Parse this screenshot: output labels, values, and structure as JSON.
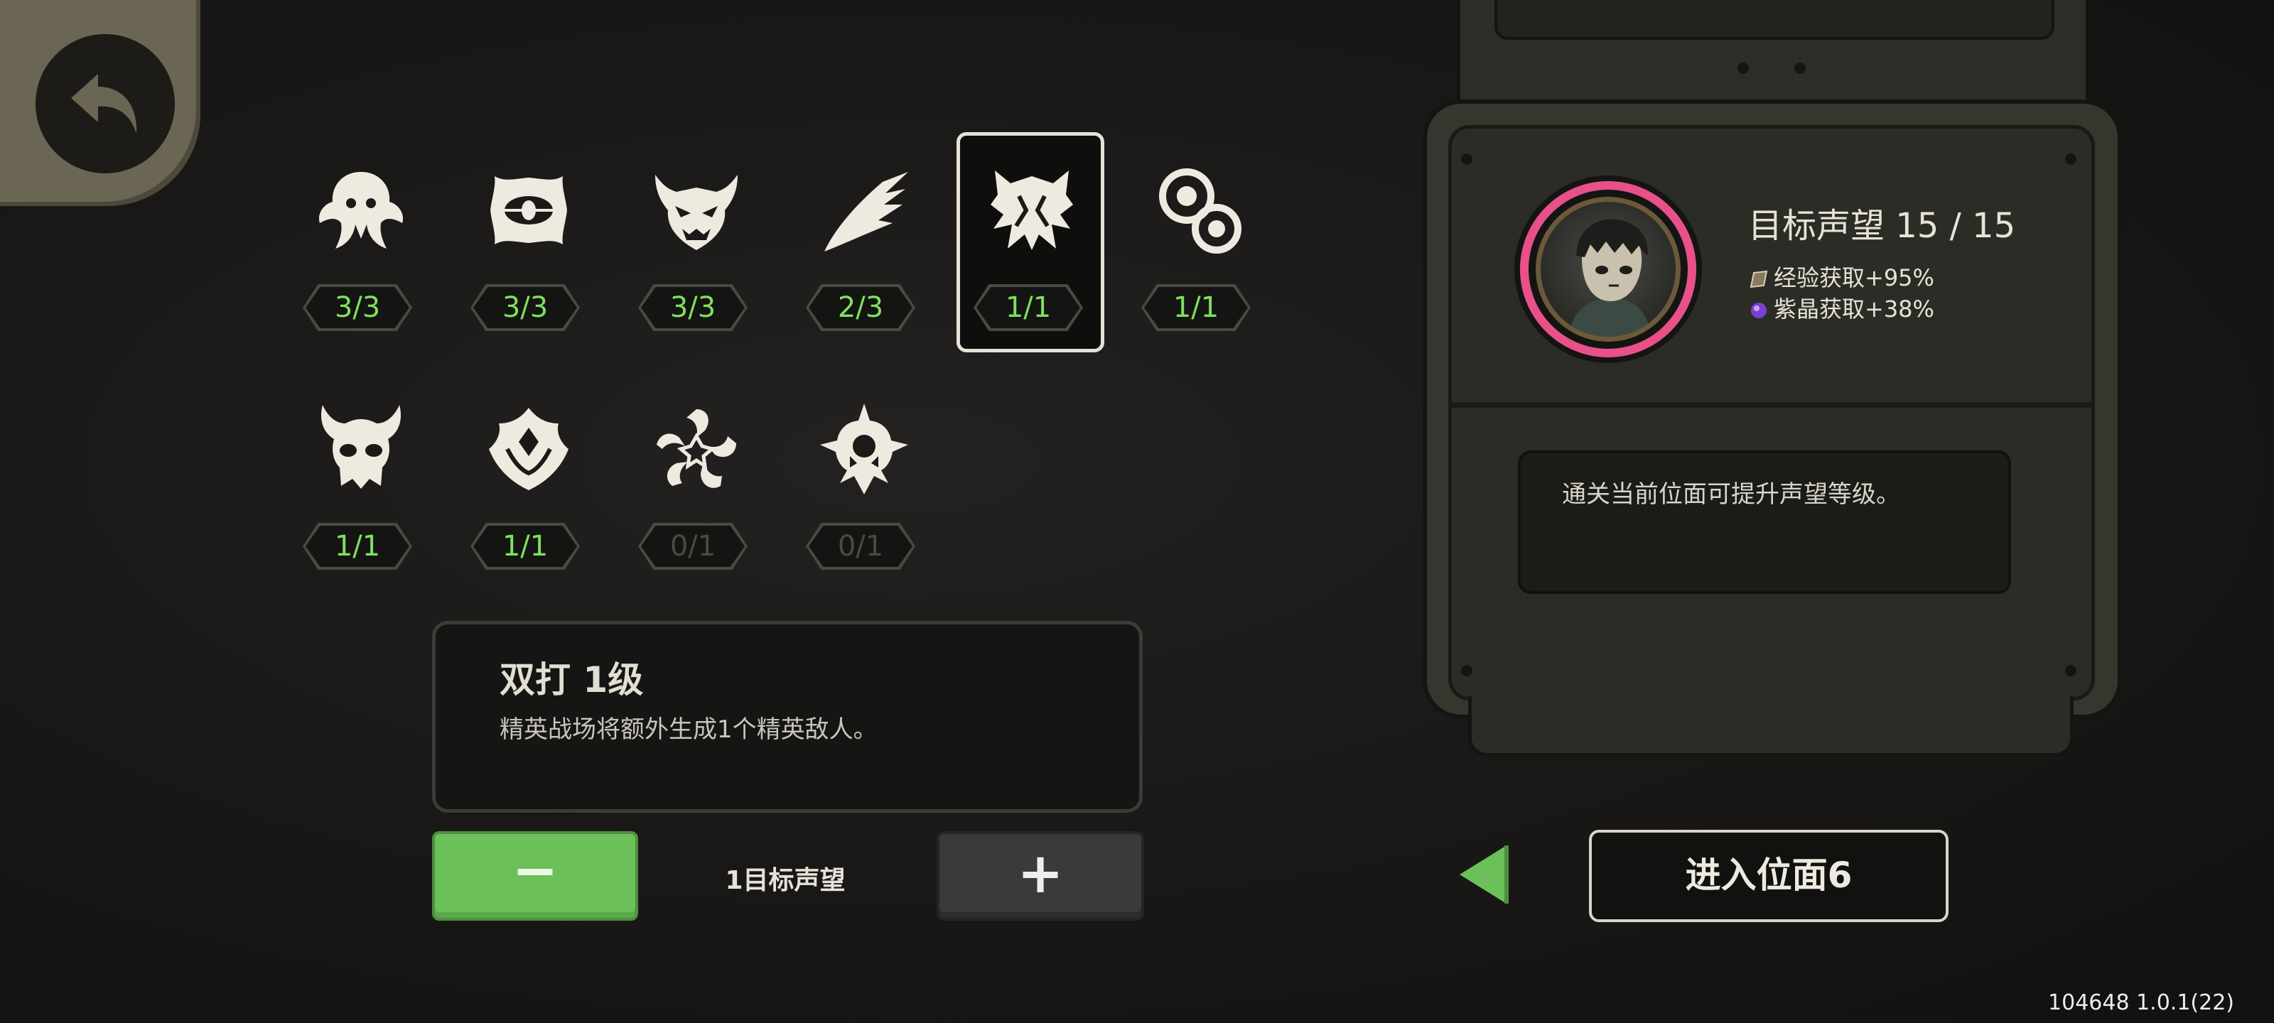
{
  "modifiers_row1": [
    {
      "count": "3/3",
      "icon": "jellyfish-crest-icon"
    },
    {
      "count": "3/3",
      "icon": "eye-blob-icon"
    },
    {
      "count": "3/3",
      "icon": "demon-mask-icon"
    },
    {
      "count": "2/3",
      "icon": "claw-streak-icon"
    },
    {
      "count": "1/1",
      "icon": "double-strike-icon"
    },
    {
      "count": "1/1",
      "icon": "bubble-cluster-icon"
    }
  ],
  "modifiers_row2": [
    {
      "count": "1/1",
      "icon": "horned-skull-icon"
    },
    {
      "count": "1/1",
      "icon": "flame-emblem-icon"
    },
    {
      "count": "0/1",
      "icon": "swirl-star-icon"
    },
    {
      "count": "0/1",
      "icon": "spiked-sigil-icon"
    }
  ],
  "detail": {
    "title": "双打 1级",
    "body": "精英战场将额外生成1个精英敌人。"
  },
  "controls": {
    "minus_label": "−",
    "plus_label": "+",
    "cost_label": "1目标声望"
  },
  "reputation": {
    "title": "目标声望 15 / 15",
    "exp_bonus": "经验获取+95%",
    "crystal_bonus": "紫晶获取+38%",
    "tip": "通关当前位面可提升声望等级。",
    "progress_fraction": 1.0,
    "ring_color": "#e8508a"
  },
  "enter_button": "进入位面6",
  "version": "104648 1.0.1(22)"
}
